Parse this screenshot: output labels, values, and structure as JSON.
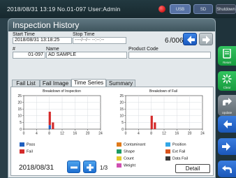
{
  "statusbar": {
    "text": "2018/08/31   13:19   No.01-097   User:Admin",
    "btn1": "USB",
    "btn2": "SD",
    "btn3": "Shutdown"
  },
  "rightpanel": {
    "reset": "Reset",
    "clear": "Clear",
    "update": "Update"
  },
  "window": {
    "title": "Inspection History",
    "start_time_label": "Start Time",
    "start_time_value": "2018/08/31 13:18:25",
    "stop_time_label": "Stop Time",
    "stop_time_value": "----/--/-- --:--:--",
    "page_current": "6",
    "page_total": "/006",
    "number_label": "#",
    "number_value": "01-097",
    "name_label": "Name",
    "name_value": "AD SAMPLE",
    "product_code_label": "Product Code",
    "product_code_value": ""
  },
  "tabs": [
    "Fail List",
    "Fail Image",
    "Time Series",
    "Summary"
  ],
  "charts": {
    "left_title": "Breakdown of Inspection",
    "right_title": "Breakdown of Fail"
  },
  "legend": {
    "left": [
      {
        "label": "Pass",
        "color": "#1f5fbf"
      },
      {
        "label": "Fail",
        "color": "#d42a2a"
      }
    ],
    "right": [
      {
        "label": "Contaminant",
        "color": "#e07a1a"
      },
      {
        "label": "Position",
        "color": "#34a7e6"
      },
      {
        "label": "Shape",
        "color": "#1d9b63"
      },
      {
        "label": "Ext Fail",
        "color": "#d9541c"
      },
      {
        "label": "Count",
        "color": "#e2c82a"
      },
      {
        "label": "Data Fail",
        "color": "#3a3a3a"
      },
      {
        "label": "Weight",
        "color": "#cf4fb1"
      }
    ]
  },
  "chart_data": [
    {
      "type": "bar",
      "title": "Breakdown of Inspection",
      "x_ticks": [
        0,
        4,
        8,
        12,
        16,
        20,
        24
      ],
      "y_ticks": [
        0,
        5,
        10,
        15,
        20,
        25
      ],
      "xlim": [
        0,
        24
      ],
      "ylim": [
        0,
        25
      ],
      "stacked": true,
      "series": [
        {
          "name": "Pass",
          "color": "#1f5fbf",
          "points": [
            {
              "x": 8,
              "y": 3
            },
            {
              "x": 9,
              "y": 0
            }
          ]
        },
        {
          "name": "Fail",
          "color": "#d42a2a",
          "points": [
            {
              "x": 8,
              "y": 10
            },
            {
              "x": 9,
              "y": 5
            }
          ]
        }
      ]
    },
    {
      "type": "bar",
      "title": "Breakdown of Fail",
      "x_ticks": [
        0,
        4,
        8,
        12,
        16,
        20,
        24
      ],
      "y_ticks": [
        0,
        5,
        10,
        15,
        20,
        25
      ],
      "xlim": [
        0,
        24
      ],
      "ylim": [
        0,
        25
      ],
      "series": [
        {
          "name": "Fail",
          "color": "#d42a2a",
          "points": [
            {
              "x": 8,
              "y": 10
            },
            {
              "x": 9,
              "y": 5
            }
          ]
        }
      ]
    }
  ],
  "footer": {
    "date": "2018/08/31",
    "page": "1/3",
    "detail_label": "Detail"
  }
}
